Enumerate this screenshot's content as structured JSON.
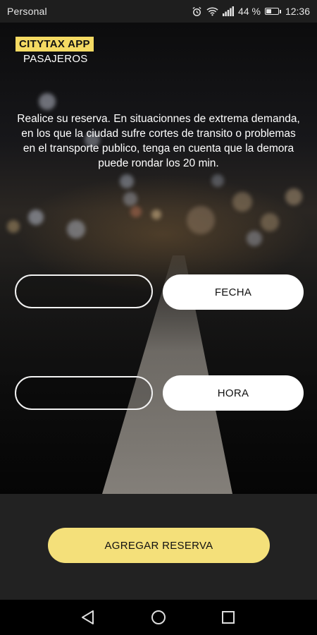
{
  "status_bar": {
    "carrier": "Personal",
    "battery": "44 %",
    "battery_level": 0.44,
    "time": "12:36",
    "icons": [
      "alarm-icon",
      "wifi-icon",
      "signal-icon",
      "battery-icon"
    ]
  },
  "brand": {
    "name": "CITYTAX APP",
    "subtitle": "PASAJEROS",
    "accent_color": "#f4da63"
  },
  "main": {
    "info_text": "Realice su reserva. En situacionnes de extrema demanda, en los que la ciudad sufre cortes de transito o problemas en el transporte publico, tenga en cuenta que la demora puede rondar los 20 min.",
    "date_field_value": "",
    "date_button_label": "FECHA",
    "time_field_value": "",
    "time_button_label": "HORA"
  },
  "footer": {
    "add_button_label": "AGREGAR RESERVA",
    "add_button_color": "#f4e07a"
  },
  "nav": {
    "icons": [
      "back-icon",
      "home-icon",
      "recents-icon"
    ]
  }
}
